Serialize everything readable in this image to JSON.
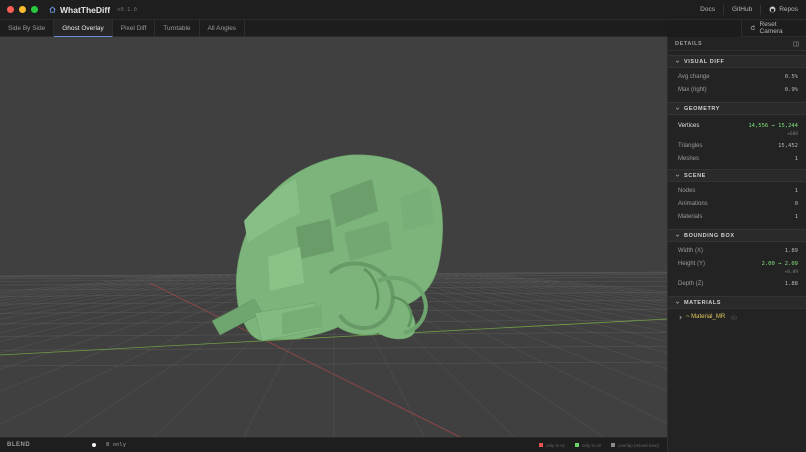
{
  "window": {
    "app_name": "WhatTheDiff",
    "version": "v0.1.0",
    "traffic_colors": [
      "#ff5f57",
      "#febc2e",
      "#28c840"
    ]
  },
  "topnav": {
    "docs": "Docs",
    "github": "GitHub",
    "repos": "Repos"
  },
  "tabs": [
    {
      "label": "Side By Side",
      "active": false
    },
    {
      "label": "Ghost Overlay",
      "active": true
    },
    {
      "label": "Pixel Diff",
      "active": false
    },
    {
      "label": "Turntable",
      "active": false
    },
    {
      "label": "All Angles",
      "active": false
    }
  ],
  "toolbar": {
    "reset_camera": "Reset Camera"
  },
  "viewport": {
    "background": "#404040",
    "model_color": "#7fb57e",
    "grid_color": "#5a5a5a",
    "axis_x_color": "#a04a4a",
    "axis_z_color": "#6a9a4a"
  },
  "status": {
    "blend_label": "BLEND",
    "blend_value": "B only",
    "legend": [
      {
        "label": "only in v1",
        "color": "#e0584f"
      },
      {
        "label": "only in v2",
        "color": "#6fd36a"
      },
      {
        "label": "overlap (mixed tone)",
        "color": "#8a8a8a"
      }
    ]
  },
  "panel": {
    "title": "DETAILS",
    "sections": {
      "visual_diff": {
        "title": "VISUAL DIFF",
        "rows": [
          {
            "k": "Avg change",
            "v": "0.5%"
          },
          {
            "k": "Max (right)",
            "v": "0.9%"
          }
        ]
      },
      "geometry": {
        "title": "GEOMETRY",
        "vertices_label": "Vertices",
        "vertices_value": "14,556 → 15,244",
        "vertices_delta": "+688",
        "rows": [
          {
            "k": "Triangles",
            "v": "15,452"
          },
          {
            "k": "Meshes",
            "v": "1"
          }
        ]
      },
      "scene": {
        "title": "SCENE",
        "rows": [
          {
            "k": "Nodes",
            "v": "1"
          },
          {
            "k": "Animations",
            "v": "0"
          },
          {
            "k": "Materials",
            "v": "1"
          }
        ]
      },
      "bounding_box": {
        "title": "BOUNDING BOX",
        "width_label": "Width (X)",
        "width_value": "1.89",
        "height_label": "Height (Y)",
        "height_value": "2.00 → 2.09",
        "height_delta": "+0.09",
        "depth_label": "Depth (Z)",
        "depth_value": "1.88"
      },
      "materials": {
        "title": "MATERIALS",
        "item": "~ Material_MR",
        "count": "(1)"
      }
    }
  }
}
